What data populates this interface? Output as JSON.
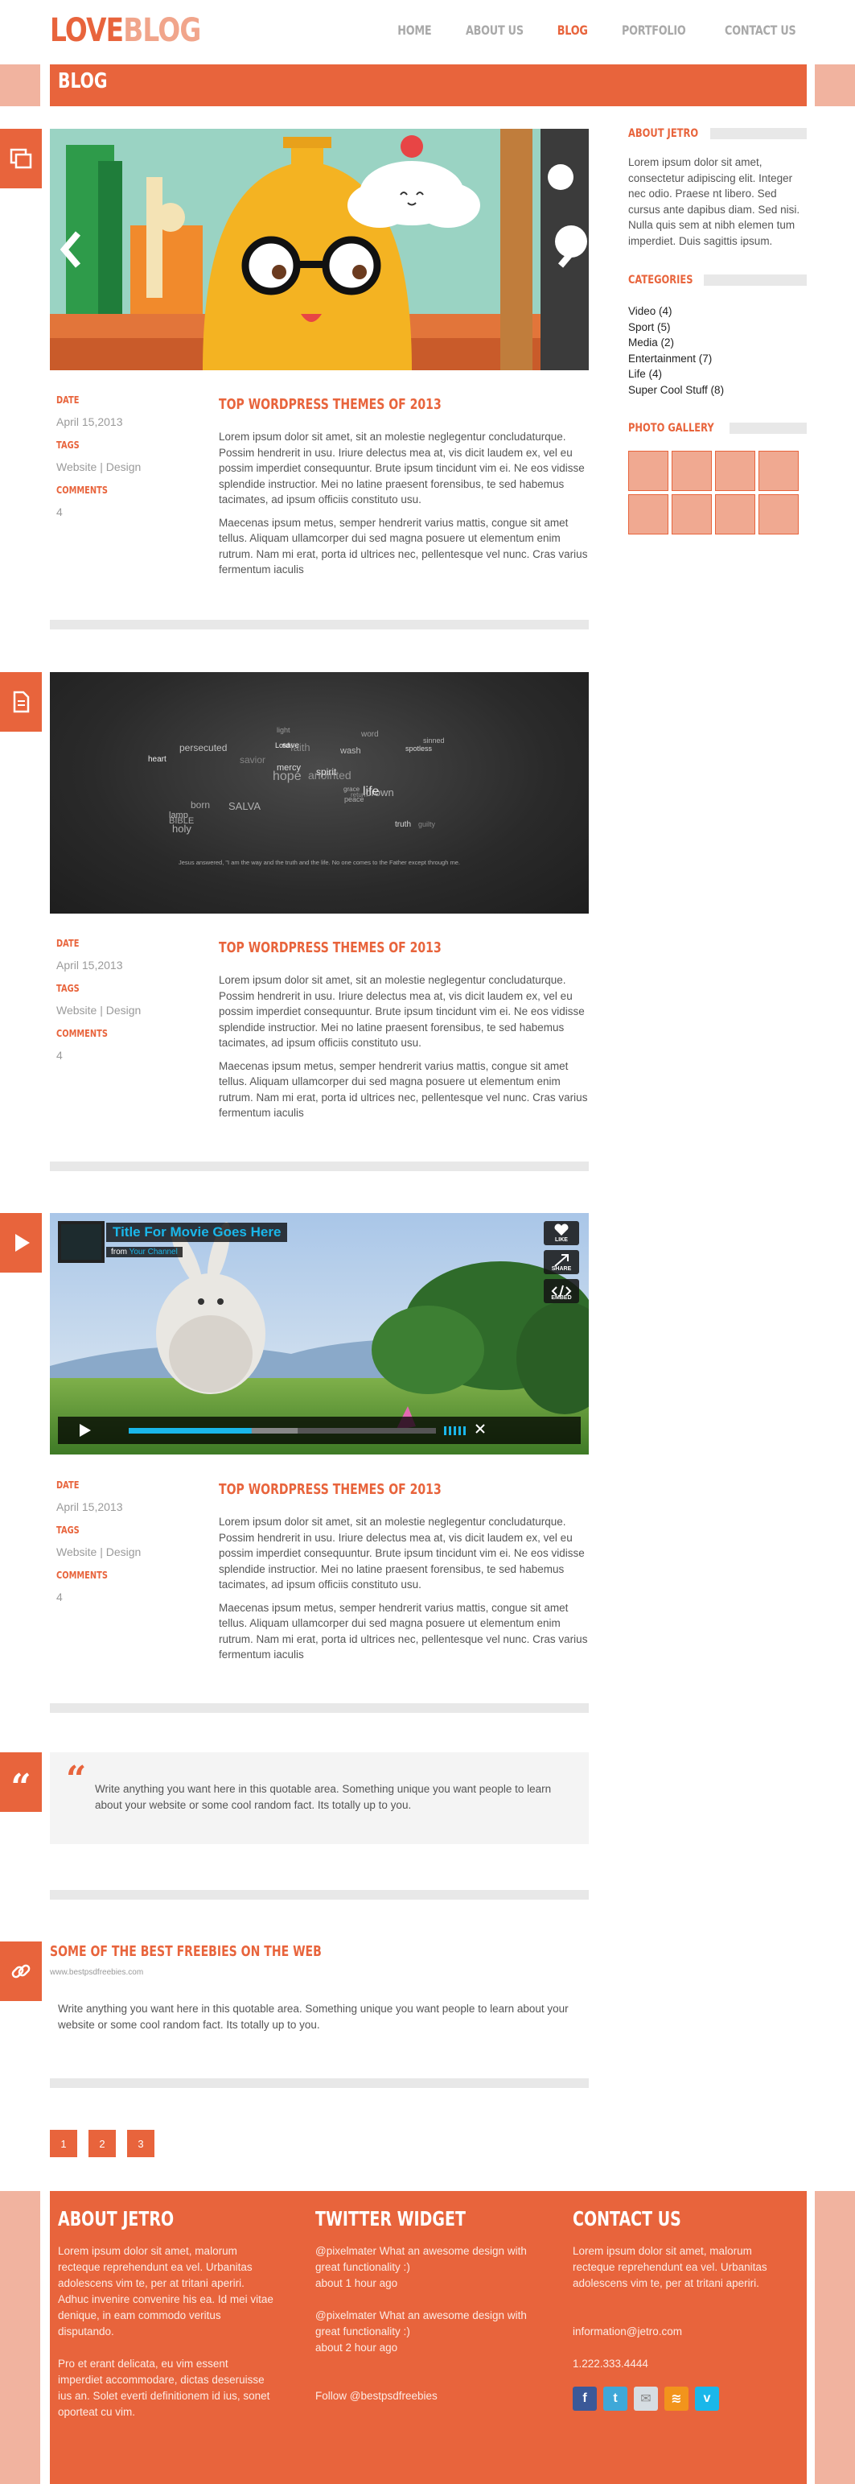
{
  "header": {
    "logo_a": "LOVE",
    "logo_b": "BLOG",
    "nav": [
      "HOME",
      "ABOUT US",
      "BLOG",
      "PORTFOLIO",
      "CONTACT US"
    ],
    "active_nav": "BLOG"
  },
  "page_title": "BLOG",
  "posts": [
    {
      "date_label": "DATE",
      "date": "April 15,2013",
      "tags_label": "TAGS",
      "tags": "Website | Design",
      "comments_label": "COMMENTS",
      "comments": "4",
      "title": "TOP WORDPRESS THEMES OF 2013",
      "p1": "Lorem ipsum dolor sit amet, sit an molestie neglegentur concludaturque. Possim hendrerit in usu. Iriure delectus mea at, vis dicit laudem ex, vel eu possim imperdiet consequuntur. Brute ipsum tincidunt vim ei. Ne eos vidisse splendide instructior. Mei no latine praesent forensibus, te sed habemus tacimates, ad ipsum officiis constituto usu.",
      "p2": "Maecenas ipsum metus, semper hendrerit varius mattis, congue sit amet tellus. Aliquam ullamcorper dui sed magna posuere ut elementum enim rutrum. Nam mi erat, porta id ultrices nec, pellentesque vel nunc. Cras varius fermentum iaculis"
    },
    {
      "date_label": "DATE",
      "date": "April 15,2013",
      "tags_label": "TAGS",
      "tags": "Website | Design",
      "comments_label": "COMMENTS",
      "comments": "4",
      "title": "TOP WORDPRESS THEMES OF 2013",
      "p1": "Lorem ipsum dolor sit amet, sit an molestie neglegentur concludaturque. Possim hendrerit in usu. Iriure delectus mea at, vis dicit laudem ex, vel eu possim imperdiet consequuntur. Brute ipsum tincidunt vim ei. Ne eos vidisse splendide instructior. Mei no latine praesent forensibus, te sed habemus tacimates, ad ipsum officiis constituto usu.",
      "p2": "Maecenas ipsum metus, semper hendrerit varius mattis, congue sit amet tellus. Aliquam ullamcorper dui sed magna posuere ut elementum enim rutrum. Nam mi erat, porta id ultrices nec, pellentesque vel nunc. Cras varius fermentum iaculis"
    },
    {
      "date_label": "DATE",
      "date": "April 15,2013",
      "tags_label": "TAGS",
      "tags": "Website | Design",
      "comments_label": "COMMENTS",
      "comments": "4",
      "title": "TOP WORDPRESS THEMES OF 2013",
      "p1": "Lorem ipsum dolor sit amet, sit an molestie neglegentur concludaturque. Possim hendrerit in usu. Iriure delectus mea at, vis dicit laudem ex, vel eu possim imperdiet consequuntur. Brute ipsum tincidunt vim ei. Ne eos vidisse splendide instructior. Mei no latine praesent forensibus, te sed habemus tacimates, ad ipsum officiis constituto usu.",
      "p2": "Maecenas ipsum metus, semper hendrerit varius mattis, congue sit amet tellus. Aliquam ullamcorper dui sed magna posuere ut elementum enim rutrum. Nam mi erat, porta id ultrices nec, pellentesque vel nunc. Cras varius fermentum iaculis"
    }
  ],
  "wordcloud_caption": "Jesus answered, \"I am the way and the truth and the life. No one comes to the Father except through me.",
  "wordcloud_words": [
    "persecuted",
    "lamp",
    "SALVA",
    "faith",
    "anointed",
    "guilty",
    "sinned",
    "wash",
    "Lord",
    "born",
    "BIBLE",
    "save",
    "crown",
    "light",
    "grace",
    "hope",
    "mercy",
    "word",
    "truth",
    "life",
    "savior",
    "peace",
    "heart",
    "holy",
    "spirit",
    "spotless",
    "return"
  ],
  "video": {
    "title": "Title For Movie Goes Here",
    "from": "from",
    "channel": "Your Channel",
    "like": "LIKE",
    "share": "SHARE",
    "embed": "EMBED",
    "progress": 0.4,
    "buffered": 0.55
  },
  "quote": {
    "mark": "“",
    "text": "Write anything you want here in this quotable area. Something unique you want people to learn about your website or some cool random fact. Its totally up to you."
  },
  "link_post": {
    "title": "SOME OF THE BEST FREEBIES ON THE WEB",
    "url": "www.bestpsdfreebies.com",
    "text": "Write anything you want here in this quotable area. Something unique you want people to learn about your website or some cool random fact. Its totally up to you."
  },
  "pagination": [
    "1",
    "2",
    "3"
  ],
  "sidebar": {
    "about_title": "ABOUT JETRO",
    "about_text": "Lorem ipsum dolor sit amet, consectetur adipiscing elit. Integer nec odio. Praese nt libero. Sed cursus ante dapibus diam. Sed nisi. Nulla quis sem at nibh elemen tum imperdiet. Duis sagittis ipsum.",
    "categories_title": "CATEGORIES",
    "categories": [
      "Video (4)",
      "Sport (5)",
      "Media (2)",
      "Entertainment (7)",
      "Life (4)",
      "Super Cool Stuff (8)"
    ],
    "gallery_title": "PHOTO GALLERY"
  },
  "footer": {
    "about_title": "ABOUT JETRO",
    "about_p1": "Lorem ipsum dolor sit amet, malorum recteque reprehendunt ea vel. Urbanitas adolescens vim te, per at tritani aperiri. Adhuc invenire convenire his ea. Id mei vitae denique, in eam commodo veritus disputando.",
    "about_p2": "Pro et erant delicata, eu vim essent imperdiet accommodare, dictas deseruisse ius an. Solet everti definitionem id ius, sonet oporteat cu vim.",
    "twitter_title": "TWITTER WIDGET",
    "tweets": [
      {
        "text": "@pixelmater What an awesome design with great functionality :)",
        "time": "about 1 hour ago"
      },
      {
        "text": "@pixelmater What an awesome design with great functionality :)",
        "time": "about 2 hour ago"
      }
    ],
    "follow": "Follow @bestpsdfreebies",
    "contact_title": "CONTACT US",
    "contact_text": "Lorem ipsum dolor sit amet, malorum recteque reprehendunt ea vel. Urbanitas adolescens vim te, per at tritani aperiri.",
    "email": "information@jetro.com",
    "phone": "1.222.333.4444",
    "social_icons": [
      "facebook-icon",
      "twitter-icon",
      "mail-icon",
      "rss-icon",
      "vimeo-icon"
    ]
  },
  "colors": {
    "accent": "#e8643c",
    "accent_light": "#f1b39f",
    "divider": "#e8e8e8"
  }
}
